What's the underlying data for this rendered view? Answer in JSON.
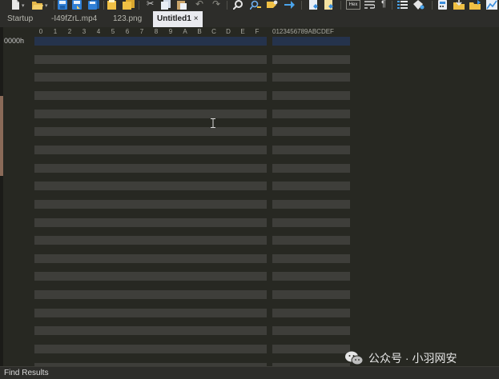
{
  "toolbar": {
    "icons": [
      "new-file-icon",
      "open-icon",
      "save-icon",
      "save-as-icon",
      "save-all-icon",
      "close-icon",
      "close-all-icon",
      "cut-icon",
      "copy-icon",
      "paste-icon",
      "undo-icon",
      "redo-icon",
      "find-icon",
      "replace-icon",
      "find-next-icon",
      "goto-icon",
      "script-icon",
      "template-icon",
      "hex-toggle-icon",
      "wrap-icon",
      "pilcrow-icon",
      "list-icon",
      "bookmark-icon",
      "calculator-icon",
      "import-icon",
      "export-icon",
      "chart-icon"
    ],
    "hex_toggle_label": "Hex"
  },
  "tabs": [
    {
      "label": "Startup",
      "active": false
    },
    {
      "label": "-I49fZrL.mp4",
      "active": false
    },
    {
      "label": "123.png",
      "active": false
    },
    {
      "label": "Untitled1",
      "active": true,
      "close": "×"
    }
  ],
  "hex_header": {
    "columns": [
      "0",
      "1",
      "2",
      "3",
      "4",
      "5",
      "6",
      "7",
      "8",
      "9",
      "A",
      "B",
      "C",
      "D",
      "E",
      "F"
    ],
    "ascii": "0123456789ABCDEF"
  },
  "editor": {
    "offsets": [
      "0000h"
    ],
    "row_count": 19
  },
  "watermark": {
    "text": "公众号 · 小羽网安"
  },
  "bottom_panel": {
    "label": "Find Results"
  }
}
